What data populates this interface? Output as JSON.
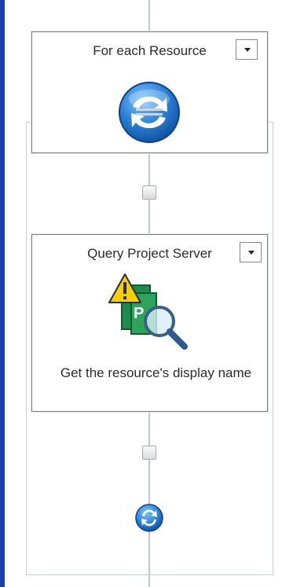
{
  "activities": [
    {
      "title": "For each Resource",
      "icon": "loop-arrows-icon"
    },
    {
      "title": "Query Project Server",
      "icon": "project-query-warning-icon",
      "description": "Get the resource's display name"
    }
  ],
  "loop_end_icon": "loop-end-icon",
  "colors": {
    "window_edge": "#1e3fae",
    "connector_line": "#b9c7d6",
    "icon_blue": "#1f6fc5",
    "warning_yellow": "#f5d000",
    "project_green": "#1f8a4c"
  }
}
